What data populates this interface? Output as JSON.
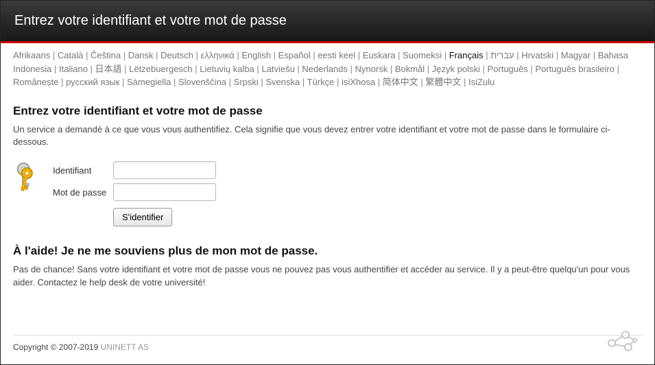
{
  "header": {
    "title": "Entrez votre identifiant et votre mot de passe"
  },
  "languages": {
    "current": "Français",
    "items": [
      "Afrikaans",
      "Català",
      "Čeština",
      "Dansk",
      "Deutsch",
      "ελληνικά",
      "English",
      "Español",
      "eesti keel",
      "Euskara",
      "Suomeksi",
      "Français",
      "עברית",
      "Hrvatski",
      "Magyar",
      "Bahasa Indonesia",
      "Italiano",
      "日本語",
      "Lëtzebuergesch",
      "Lietuvių kalba",
      "Latviešu",
      "Nederlands",
      "Nynorsk",
      "Bokmål",
      "Język polski",
      "Português",
      "Português brasileiro",
      "Românește",
      "русский язык",
      "Sámegiella",
      "Slovenščina",
      "Srpski",
      "Svenska",
      "Türkçe",
      "isiXhosa",
      "简体中文",
      "繁體中文",
      "IsiZulu"
    ]
  },
  "main": {
    "heading": "Entrez votre identifiant et votre mot de passe",
    "intro": "Un service a demandé à ce que vous vous authentifiez. Cela signifie que vous devez entrer votre identifiant et votre mot de passe dans le formulaire ci-dessous.",
    "form": {
      "username_label": "Identifiant",
      "password_label": "Mot de passe",
      "submit_label": "S'identifier"
    },
    "help_heading": "À l'aide! Je ne me souviens plus de mon mot de passe.",
    "help_text": "Pas de chance! Sans votre identifiant et votre mot de passe vous ne pouvez pas vous authentifier et accéder au service. Il y a peut-être quelqu'un pour vous aider. Contactez le help desk de votre université!"
  },
  "footer": {
    "copyright": "Copyright © 2007-2019 ",
    "link_label": "UNINETT AS"
  }
}
